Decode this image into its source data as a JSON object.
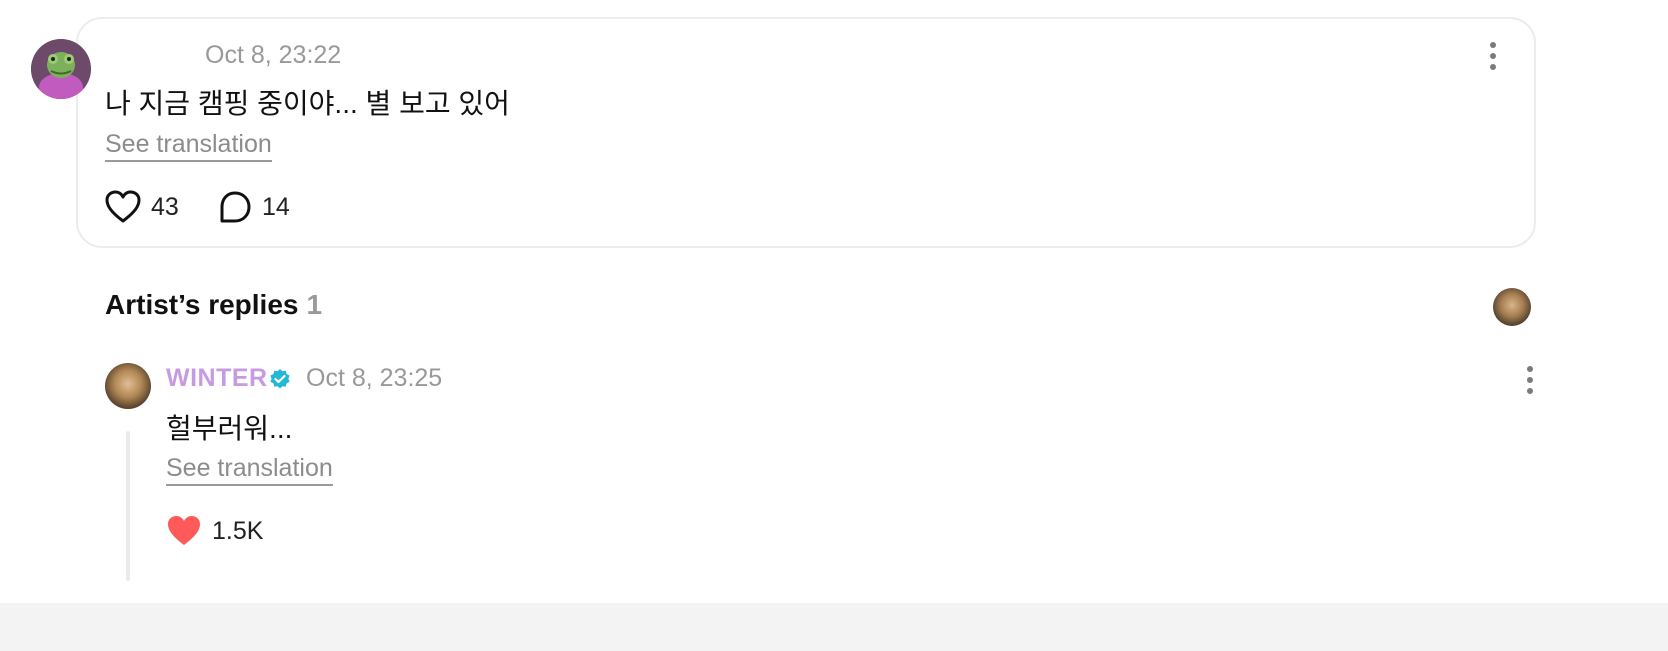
{
  "post": {
    "author_name": "",
    "time": "Oct 8, 23:22",
    "text": "나 지금 캠핑 중이야... 별 보고 있어",
    "see_translation": "See translation",
    "likes": "43",
    "comments": "14"
  },
  "artist_replies": {
    "title": "Artist’s replies",
    "count": "1"
  },
  "reply": {
    "author_name": "WINTER",
    "time": "Oct 8, 23:25",
    "text": "헐부러워...",
    "see_translation": "See translation",
    "likes": "1.5K"
  },
  "colors": {
    "artist_name": "#c79be2",
    "verified_badge": "#22b8d6",
    "liked_heart": "#ff5a5a",
    "card_border": "#ececec"
  },
  "icons": {
    "post_like": "heart-outline-icon",
    "post_comment": "comment-bubble-icon",
    "reply_like": "heart-filled-icon",
    "verified": "verified-badge-icon",
    "menu": "kebab-menu-icon"
  }
}
